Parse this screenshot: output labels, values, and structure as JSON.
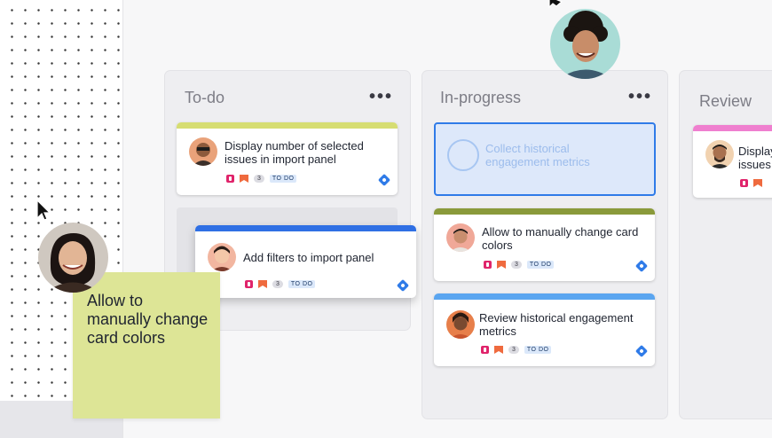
{
  "columns": [
    {
      "title": "To-do",
      "menu": "•••"
    },
    {
      "title": "In-progress",
      "menu": "•••"
    },
    {
      "title": "Review"
    }
  ],
  "cards": {
    "todo_1": {
      "title": "Display number of selected issues in import panel",
      "count": "3",
      "status": "TO DO"
    },
    "todo_drag": {
      "title": "Add filters to import panel",
      "count": "3",
      "status": "TO DO"
    },
    "inprog_placeholder": {
      "title": "Collect historical engagement metrics"
    },
    "inprog_1": {
      "title": "Allow to manually change card colors",
      "count": "3",
      "status": "TO DO"
    },
    "inprog_2": {
      "title": "Review historical engagement metrics",
      "count": "3",
      "status": "TO DO"
    },
    "review_1": {
      "title": "Display issues"
    }
  },
  "sticky_note": {
    "text": "Allow to manually change card colors"
  },
  "colors": {
    "lime": "#d6dd72",
    "olive": "#8a9a3b",
    "blue": "#2f6fe4",
    "sky": "#5aa5f0",
    "pink": "#ef7fcf",
    "sticky": "#dde596",
    "placeholder_bg": "#dde8fa",
    "placeholder_border": "#2f7be8"
  }
}
